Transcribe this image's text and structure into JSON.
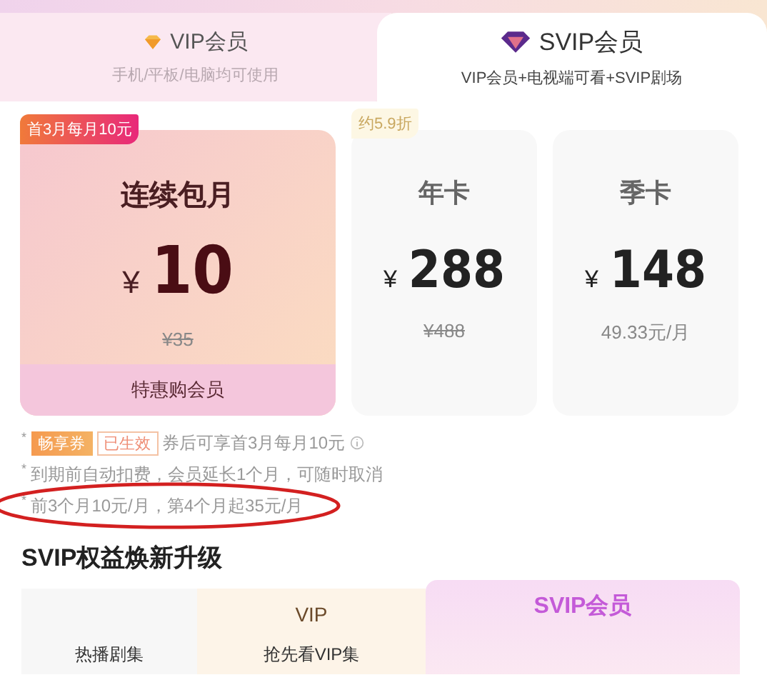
{
  "tabs": [
    {
      "title": "VIP会员",
      "subtitle": "手机/平板/电脑均可使用",
      "selected": false
    },
    {
      "title": "SVIP会员",
      "subtitle": "VIP会员+电视端可看+SVIP剧场",
      "selected": true
    }
  ],
  "plans": [
    {
      "badge": "首3月每月10元",
      "name": "连续包月",
      "currency": "¥",
      "price": "10",
      "original_price": "¥35",
      "footer": "特惠购会员",
      "selected": true
    },
    {
      "badge": "约5.9折",
      "name": "年卡",
      "currency": "¥",
      "price": "288",
      "original_price": "¥488",
      "selected": false
    },
    {
      "name": "季卡",
      "currency": "¥",
      "price": "148",
      "per_month": "49.33元/月",
      "selected": false
    }
  ],
  "notes": [
    {
      "kind": "coupon",
      "marker": "*",
      "coupon": "畅享券",
      "status": "已生效",
      "text": "券后可享首3月每月10元"
    },
    {
      "kind": "text",
      "marker": "*",
      "text": "到期前自动扣费，会员延长1个月，可随时取消"
    },
    {
      "kind": "text",
      "marker": "*",
      "text": "前3个月10元/月，第4个月起35元/月",
      "circled": true
    }
  ],
  "benefits": {
    "title": "SVIP权益焕新升级",
    "columns": [
      "VIP",
      "SVIP会员"
    ],
    "rows": [
      {
        "label": "热播剧集",
        "vip": "抢先看VIP集"
      }
    ]
  }
}
